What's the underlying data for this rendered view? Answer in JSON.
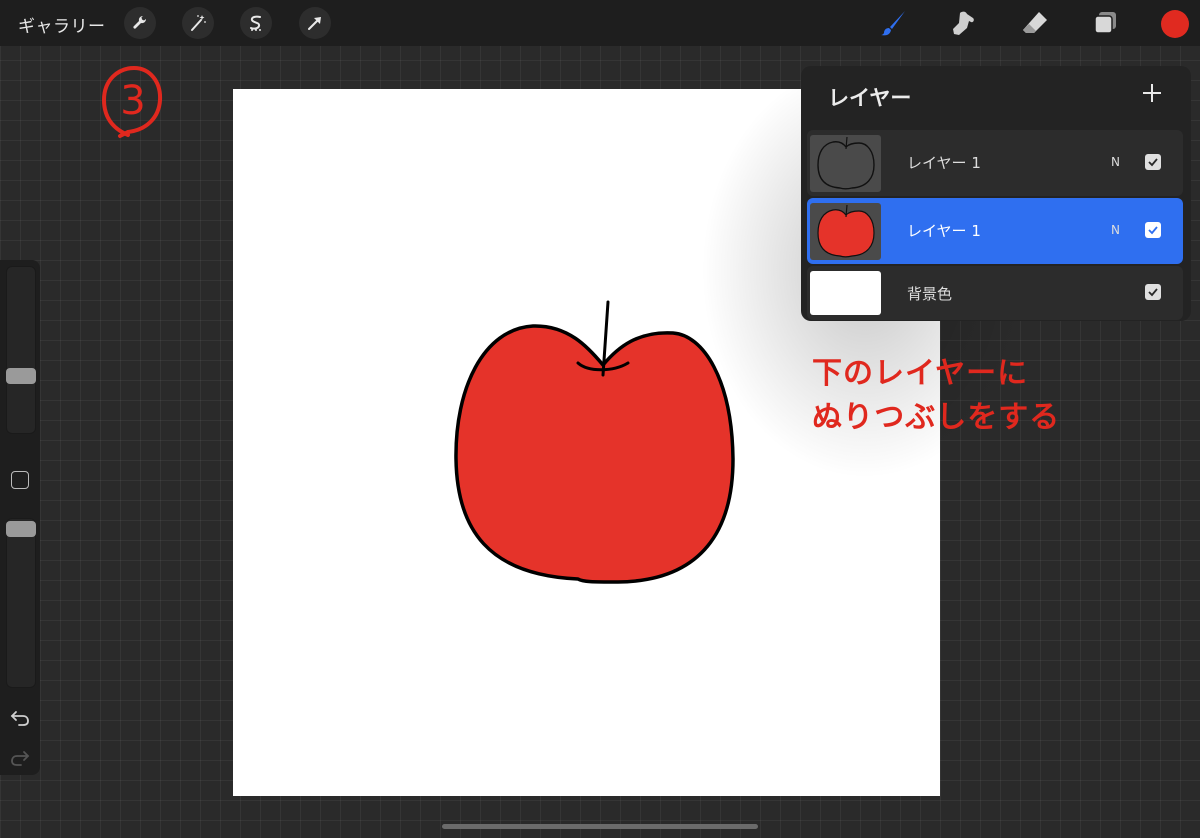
{
  "topbar": {
    "gallery_label": "ギャラリー",
    "left_tools": [
      "wrench-icon",
      "magic-wand-icon",
      "selection-icon",
      "transform-arrow-icon"
    ],
    "right_tools": [
      "brush-icon",
      "smudge-icon",
      "eraser-icon",
      "layers-icon"
    ],
    "accent_color": "#2f6ff0",
    "current_color": "#e02a20"
  },
  "annotation": {
    "step_number": "3",
    "note_line1": "下のレイヤーに",
    "note_line2": "ぬりつぶしをする",
    "note_color": "#e0281e"
  },
  "layers_panel": {
    "title": "レイヤー",
    "add_icon": "plus-icon",
    "layers": [
      {
        "name": "レイヤー 1",
        "mode": "N",
        "visible": true,
        "selected": false,
        "thumb": "apple-outline"
      },
      {
        "name": "レイヤー 1",
        "mode": "N",
        "visible": true,
        "selected": true,
        "thumb": "apple-filled"
      },
      {
        "name": "背景色",
        "mode": "",
        "visible": true,
        "selected": false,
        "thumb": "white-background"
      }
    ]
  },
  "sidebar": {
    "icons": [
      "brush-size-slider",
      "modify-square-icon",
      "opacity-slider",
      "undo-icon",
      "redo-icon"
    ]
  }
}
